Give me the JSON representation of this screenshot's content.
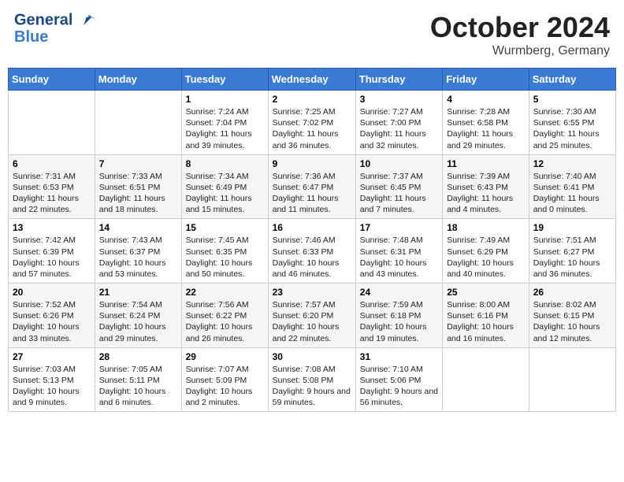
{
  "header": {
    "logo_line1": "General",
    "logo_line2": "Blue",
    "month": "October 2024",
    "location": "Wurmberg, Germany"
  },
  "weekdays": [
    "Sunday",
    "Monday",
    "Tuesday",
    "Wednesday",
    "Thursday",
    "Friday",
    "Saturday"
  ],
  "weeks": [
    [
      {
        "day": "",
        "sunrise": "",
        "sunset": "",
        "daylight": ""
      },
      {
        "day": "",
        "sunrise": "",
        "sunset": "",
        "daylight": ""
      },
      {
        "day": "1",
        "sunrise": "Sunrise: 7:24 AM",
        "sunset": "Sunset: 7:04 PM",
        "daylight": "Daylight: 11 hours and 39 minutes."
      },
      {
        "day": "2",
        "sunrise": "Sunrise: 7:25 AM",
        "sunset": "Sunset: 7:02 PM",
        "daylight": "Daylight: 11 hours and 36 minutes."
      },
      {
        "day": "3",
        "sunrise": "Sunrise: 7:27 AM",
        "sunset": "Sunset: 7:00 PM",
        "daylight": "Daylight: 11 hours and 32 minutes."
      },
      {
        "day": "4",
        "sunrise": "Sunrise: 7:28 AM",
        "sunset": "Sunset: 6:58 PM",
        "daylight": "Daylight: 11 hours and 29 minutes."
      },
      {
        "day": "5",
        "sunrise": "Sunrise: 7:30 AM",
        "sunset": "Sunset: 6:55 PM",
        "daylight": "Daylight: 11 hours and 25 minutes."
      }
    ],
    [
      {
        "day": "6",
        "sunrise": "Sunrise: 7:31 AM",
        "sunset": "Sunset: 6:53 PM",
        "daylight": "Daylight: 11 hours and 22 minutes."
      },
      {
        "day": "7",
        "sunrise": "Sunrise: 7:33 AM",
        "sunset": "Sunset: 6:51 PM",
        "daylight": "Daylight: 11 hours and 18 minutes."
      },
      {
        "day": "8",
        "sunrise": "Sunrise: 7:34 AM",
        "sunset": "Sunset: 6:49 PM",
        "daylight": "Daylight: 11 hours and 15 minutes."
      },
      {
        "day": "9",
        "sunrise": "Sunrise: 7:36 AM",
        "sunset": "Sunset: 6:47 PM",
        "daylight": "Daylight: 11 hours and 11 minutes."
      },
      {
        "day": "10",
        "sunrise": "Sunrise: 7:37 AM",
        "sunset": "Sunset: 6:45 PM",
        "daylight": "Daylight: 11 hours and 7 minutes."
      },
      {
        "day": "11",
        "sunrise": "Sunrise: 7:39 AM",
        "sunset": "Sunset: 6:43 PM",
        "daylight": "Daylight: 11 hours and 4 minutes."
      },
      {
        "day": "12",
        "sunrise": "Sunrise: 7:40 AM",
        "sunset": "Sunset: 6:41 PM",
        "daylight": "Daylight: 11 hours and 0 minutes."
      }
    ],
    [
      {
        "day": "13",
        "sunrise": "Sunrise: 7:42 AM",
        "sunset": "Sunset: 6:39 PM",
        "daylight": "Daylight: 10 hours and 57 minutes."
      },
      {
        "day": "14",
        "sunrise": "Sunrise: 7:43 AM",
        "sunset": "Sunset: 6:37 PM",
        "daylight": "Daylight: 10 hours and 53 minutes."
      },
      {
        "day": "15",
        "sunrise": "Sunrise: 7:45 AM",
        "sunset": "Sunset: 6:35 PM",
        "daylight": "Daylight: 10 hours and 50 minutes."
      },
      {
        "day": "16",
        "sunrise": "Sunrise: 7:46 AM",
        "sunset": "Sunset: 6:33 PM",
        "daylight": "Daylight: 10 hours and 46 minutes."
      },
      {
        "day": "17",
        "sunrise": "Sunrise: 7:48 AM",
        "sunset": "Sunset: 6:31 PM",
        "daylight": "Daylight: 10 hours and 43 minutes."
      },
      {
        "day": "18",
        "sunrise": "Sunrise: 7:49 AM",
        "sunset": "Sunset: 6:29 PM",
        "daylight": "Daylight: 10 hours and 40 minutes."
      },
      {
        "day": "19",
        "sunrise": "Sunrise: 7:51 AM",
        "sunset": "Sunset: 6:27 PM",
        "daylight": "Daylight: 10 hours and 36 minutes."
      }
    ],
    [
      {
        "day": "20",
        "sunrise": "Sunrise: 7:52 AM",
        "sunset": "Sunset: 6:26 PM",
        "daylight": "Daylight: 10 hours and 33 minutes."
      },
      {
        "day": "21",
        "sunrise": "Sunrise: 7:54 AM",
        "sunset": "Sunset: 6:24 PM",
        "daylight": "Daylight: 10 hours and 29 minutes."
      },
      {
        "day": "22",
        "sunrise": "Sunrise: 7:56 AM",
        "sunset": "Sunset: 6:22 PM",
        "daylight": "Daylight: 10 hours and 26 minutes."
      },
      {
        "day": "23",
        "sunrise": "Sunrise: 7:57 AM",
        "sunset": "Sunset: 6:20 PM",
        "daylight": "Daylight: 10 hours and 22 minutes."
      },
      {
        "day": "24",
        "sunrise": "Sunrise: 7:59 AM",
        "sunset": "Sunset: 6:18 PM",
        "daylight": "Daylight: 10 hours and 19 minutes."
      },
      {
        "day": "25",
        "sunrise": "Sunrise: 8:00 AM",
        "sunset": "Sunset: 6:16 PM",
        "daylight": "Daylight: 10 hours and 16 minutes."
      },
      {
        "day": "26",
        "sunrise": "Sunrise: 8:02 AM",
        "sunset": "Sunset: 6:15 PM",
        "daylight": "Daylight: 10 hours and 12 minutes."
      }
    ],
    [
      {
        "day": "27",
        "sunrise": "Sunrise: 7:03 AM",
        "sunset": "Sunset: 5:13 PM",
        "daylight": "Daylight: 10 hours and 9 minutes."
      },
      {
        "day": "28",
        "sunrise": "Sunrise: 7:05 AM",
        "sunset": "Sunset: 5:11 PM",
        "daylight": "Daylight: 10 hours and 6 minutes."
      },
      {
        "day": "29",
        "sunrise": "Sunrise: 7:07 AM",
        "sunset": "Sunset: 5:09 PM",
        "daylight": "Daylight: 10 hours and 2 minutes."
      },
      {
        "day": "30",
        "sunrise": "Sunrise: 7:08 AM",
        "sunset": "Sunset: 5:08 PM",
        "daylight": "Daylight: 9 hours and 59 minutes."
      },
      {
        "day": "31",
        "sunrise": "Sunrise: 7:10 AM",
        "sunset": "Sunset: 5:06 PM",
        "daylight": "Daylight: 9 hours and 56 minutes."
      },
      {
        "day": "",
        "sunrise": "",
        "sunset": "",
        "daylight": ""
      },
      {
        "day": "",
        "sunrise": "",
        "sunset": "",
        "daylight": ""
      }
    ]
  ]
}
